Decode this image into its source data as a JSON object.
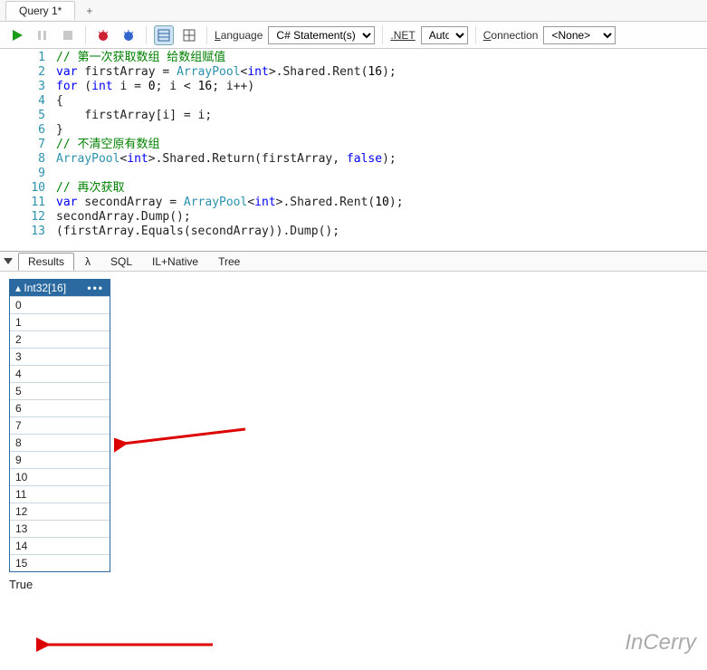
{
  "tabs": {
    "query_tab": "Query 1*",
    "add": "+"
  },
  "toolbar": {
    "language_label": "Language",
    "language_value": "C# Statement(s)",
    "net_label": ".NET",
    "net_value": "Auto",
    "connection_label": "Connection",
    "connection_value": "<None>"
  },
  "code": {
    "lines": [
      {
        "n": "1",
        "segs": [
          {
            "t": "// 第一次获取数组 给数组赋值",
            "c": "c-comment"
          }
        ]
      },
      {
        "n": "2",
        "segs": [
          {
            "t": "var",
            "c": "c-keyword"
          },
          {
            "t": " firstArray = "
          },
          {
            "t": "ArrayPool",
            "c": "c-type"
          },
          {
            "t": "<"
          },
          {
            "t": "int",
            "c": "c-keyword"
          },
          {
            "t": ">.Shared.Rent("
          },
          {
            "t": "16",
            "c": "c-num"
          },
          {
            "t": ");"
          }
        ]
      },
      {
        "n": "3",
        "segs": [
          {
            "t": "for",
            "c": "c-keyword"
          },
          {
            "t": " ("
          },
          {
            "t": "int",
            "c": "c-keyword"
          },
          {
            "t": " i = "
          },
          {
            "t": "0",
            "c": "c-num"
          },
          {
            "t": "; i < "
          },
          {
            "t": "16",
            "c": "c-num"
          },
          {
            "t": "; i++)"
          }
        ]
      },
      {
        "n": "4",
        "segs": [
          {
            "t": "{"
          }
        ]
      },
      {
        "n": "5",
        "segs": [
          {
            "t": "    firstArray[i] = i;"
          }
        ]
      },
      {
        "n": "6",
        "segs": [
          {
            "t": "}"
          }
        ]
      },
      {
        "n": "7",
        "segs": [
          {
            "t": "// 不清空原有数组",
            "c": "c-comment"
          }
        ]
      },
      {
        "n": "8",
        "segs": [
          {
            "t": "ArrayPool",
            "c": "c-type"
          },
          {
            "t": "<"
          },
          {
            "t": "int",
            "c": "c-keyword"
          },
          {
            "t": ">.Shared.Return(firstArray, "
          },
          {
            "t": "false",
            "c": "c-keyword"
          },
          {
            "t": ");"
          }
        ]
      },
      {
        "n": "9",
        "segs": [
          {
            "t": ""
          }
        ]
      },
      {
        "n": "10",
        "segs": [
          {
            "t": "// 再次获取",
            "c": "c-comment"
          }
        ]
      },
      {
        "n": "11",
        "segs": [
          {
            "t": "var",
            "c": "c-keyword"
          },
          {
            "t": " secondArray = "
          },
          {
            "t": "ArrayPool",
            "c": "c-type"
          },
          {
            "t": "<"
          },
          {
            "t": "int",
            "c": "c-keyword"
          },
          {
            "t": ">.Shared.Rent("
          },
          {
            "t": "10",
            "c": "c-num"
          },
          {
            "t": ");"
          }
        ]
      },
      {
        "n": "12",
        "segs": [
          {
            "t": "secondArray.Dump();"
          }
        ]
      },
      {
        "n": "13",
        "segs": [
          {
            "t": "(firstArray.Equals(secondArray)).Dump();"
          }
        ]
      }
    ]
  },
  "result_tabs": {
    "results": "Results",
    "lambda": "λ",
    "sql": "SQL",
    "ilnative": "IL+Native",
    "tree": "Tree"
  },
  "output": {
    "header": "Int32[16]",
    "rows": [
      "0",
      "1",
      "2",
      "3",
      "4",
      "5",
      "6",
      "7",
      "8",
      "9",
      "10",
      "11",
      "12",
      "13",
      "14",
      "15"
    ],
    "true_text": "True"
  },
  "watermark": "InCerry"
}
